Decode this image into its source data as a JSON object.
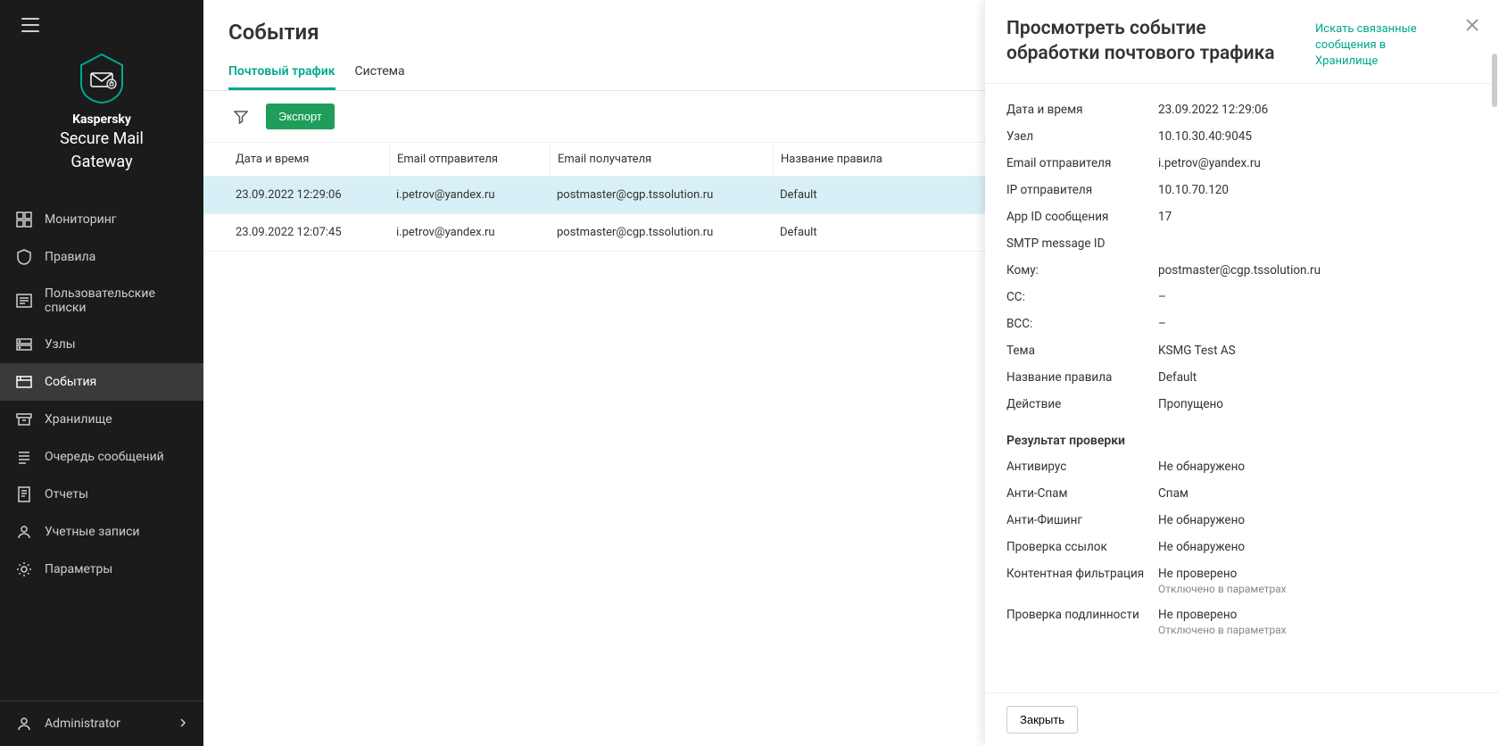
{
  "brand": {
    "name1": "Kaspersky",
    "name2_line1": "Secure Mail",
    "name2_line2": "Gateway"
  },
  "sidebar": {
    "items": [
      {
        "label": "Мониторинг"
      },
      {
        "label": "Правила"
      },
      {
        "label": "Пользовательские списки"
      },
      {
        "label": "Узлы"
      },
      {
        "label": "События"
      },
      {
        "label": "Хранилище"
      },
      {
        "label": "Очередь сообщений"
      },
      {
        "label": "Отчеты"
      },
      {
        "label": "Учетные записи"
      },
      {
        "label": "Параметры"
      }
    ],
    "footer_user": "Administrator"
  },
  "page": {
    "title": "События"
  },
  "tabs": {
    "mail": "Почтовый трафик",
    "system": "Система"
  },
  "toolbar": {
    "export": "Экспорт"
  },
  "columns": {
    "datetime": "Дата и время",
    "sender": "Email отправителя",
    "recipient": "Email получателя",
    "rule": "Название правила"
  },
  "rows": [
    {
      "datetime": "23.09.2022 12:29:06",
      "sender": "i.petrov@yandex.ru",
      "recipient": "postmaster@cgp.tssolution.ru",
      "rule": "Default"
    },
    {
      "datetime": "23.09.2022 12:07:45",
      "sender": "i.petrov@yandex.ru",
      "recipient": "postmaster@cgp.tssolution.ru",
      "rule": "Default"
    }
  ],
  "panel": {
    "title": "Просмотреть событие обработки почтового трафика",
    "search_link": "Искать связанные сообщения в Хранилище",
    "details": {
      "datetime_k": "Дата и время",
      "datetime_v": "23.09.2022 12:29:06",
      "node_k": "Узел",
      "node_v": "10.10.30.40:9045",
      "sender_k": "Email отправителя",
      "sender_v": "i.petrov@yandex.ru",
      "sender_ip_k": "IP отправителя",
      "sender_ip_v": "10.10.70.120",
      "appid_k": "App ID сообщения",
      "appid_v": "17",
      "smtpid_k": "SMTP message ID",
      "smtpid_v": "",
      "to_k": "Кому:",
      "to_v": "postmaster@cgp.tssolution.ru",
      "cc_k": "CC:",
      "cc_v": "–",
      "bcc_k": "BCC:",
      "bcc_v": "–",
      "subject_k": "Тема",
      "subject_v": "KSMG Test AS",
      "rule_k": "Название правила",
      "rule_v": "Default",
      "action_k": "Действие",
      "action_v": "Пропущено"
    },
    "scan_title": "Результат проверки",
    "scan": {
      "av_k": "Антивирус",
      "av_v": "Не обнаружено",
      "as_k": "Анти-Спам",
      "as_v": "Спам",
      "ap_k": "Анти-Фишинг",
      "ap_v": "Не обнаружено",
      "links_k": "Проверка ссылок",
      "links_v": "Не обнаружено",
      "content_k": "Контентная фильтрация",
      "content_v": "Не проверено",
      "content_sub": "Отключено в параметрах",
      "auth_k": "Проверка подлинности",
      "auth_v": "Не проверено",
      "auth_sub": "Отключено в параметрах"
    },
    "close_btn": "Закрыть"
  }
}
